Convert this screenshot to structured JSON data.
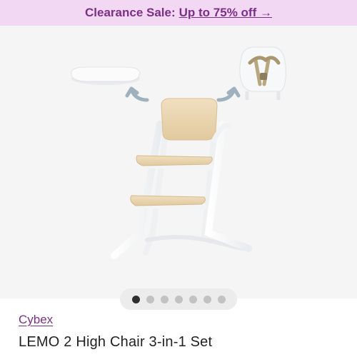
{
  "promo": {
    "text": "Clearance Sale:",
    "link": "Up to 75% off →",
    "color": "#f3d8f3"
  },
  "gallery": {
    "image_count": 7,
    "active_index": 0
  },
  "product": {
    "brand": "Cybex",
    "title": "LEMO 2 High Chair 3-in-1 Set"
  },
  "colors": {
    "accent": "#7c2f87"
  }
}
